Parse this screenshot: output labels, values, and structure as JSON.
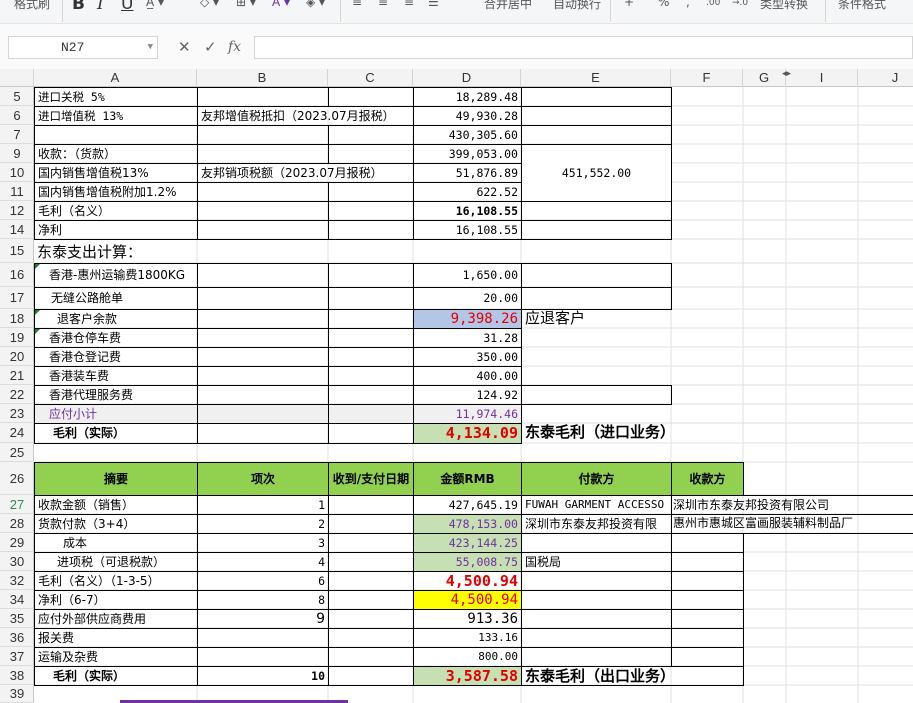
{
  "ribbon": {
    "format_label": "格式刷",
    "bold_icon": "B",
    "italic_icon": "I",
    "underline_icon": "U",
    "merge_label": "合并居中",
    "wrap_label": "自动换行",
    "plus_icon": "+",
    "percent_icon": "%",
    "dec_inc": ".00",
    "dec_dec": "→.0",
    "type_convert": "类型转换",
    "cond_format": "条件格式"
  },
  "formula_bar": {
    "name_box": "N27",
    "cancel_icon": "✕",
    "confirm_icon": "✓",
    "fx_icon": "fx",
    "formula": ""
  },
  "columns": [
    "A",
    "B",
    "C",
    "D",
    "E",
    "F",
    "G",
    "I",
    "J"
  ],
  "rows": [
    "5",
    "6",
    "7",
    "9",
    "10",
    "11",
    "12",
    "14",
    "15",
    "16",
    "17",
    "18",
    "19",
    "20",
    "21",
    "22",
    "23",
    "24",
    "25",
    "26",
    "27",
    "28",
    "29",
    "30",
    "32",
    "34",
    "35",
    "36",
    "37",
    "38",
    "39"
  ],
  "cells": {
    "r5": {
      "a": "进口关税 5%",
      "d": "18,289.48"
    },
    "r6": {
      "a": "进口增值税 13%",
      "b": "友邦增值税抵扣（2023.07月报税）",
      "d": "49,930.28"
    },
    "r7": {
      "d": "430,305.60"
    },
    "r9": {
      "a": "收款：（货款）",
      "d": "399,053.00"
    },
    "r10": {
      "a": "国内销售增值税13%",
      "b": "友邦销项税额（2023.07月报税）",
      "d": "51,876.89",
      "e": "451,552.00"
    },
    "r11": {
      "a": "国内销售增值税附加1.2%",
      "d": "622.52"
    },
    "r12": {
      "a": "毛利（名义）",
      "d": "16,108.55"
    },
    "r14": {
      "a": "净利",
      "d": "16,108.55"
    },
    "r15": {
      "a": "东泰支出计算："
    },
    "r16": {
      "a": "香港-惠州运输费1800KG",
      "d": "1,650.00"
    },
    "r17": {
      "a": "无缝公路舱单",
      "d": "20.00"
    },
    "r18": {
      "a": "退客户余款",
      "d": "9,398.26",
      "e": "应退客户"
    },
    "r19": {
      "a": "香港仓停车费",
      "d": "31.28"
    },
    "r20": {
      "a": "香港仓登记费",
      "d": "350.00"
    },
    "r21": {
      "a": "香港装车费",
      "d": "400.00"
    },
    "r22": {
      "a": "香港代理服务费",
      "d": "124.92"
    },
    "r23": {
      "a": "应付小计",
      "d": "11,974.46"
    },
    "r24": {
      "a": "毛利（实际）",
      "d": "4,134.09",
      "e": "东泰毛利（进口业务）"
    },
    "r26": {
      "a": "摘要",
      "b": "项次",
      "c": "收到/支付日期",
      "d": "金额RMB",
      "e": "付款方",
      "f": "收款方"
    },
    "r27": {
      "a": "收款金额（销售）",
      "b": "1",
      "d": "427,645.19",
      "e": "FUWAH GARMENT ACCESSO",
      "f": "深圳市东泰友邦投资有限公司"
    },
    "r28": {
      "a": "货款付款（3+4）",
      "b": "2",
      "d": "478,153.00",
      "e": "深圳市东泰友邦投资有限",
      "f": "惠州市惠城区富画服装辅料制品厂"
    },
    "r29": {
      "a": "成本",
      "b": "3",
      "d": "423,144.25"
    },
    "r30": {
      "a": "进项税（可退税款）",
      "b": "4",
      "d": "55,008.75",
      "e": "国税局"
    },
    "r32": {
      "a": "毛利（名义）（1-3-5）",
      "b": "6",
      "d": "4,500.94"
    },
    "r34": {
      "a": "净利（6-7）",
      "b": "8",
      "d": "4,500.94"
    },
    "r35": {
      "a": "应付外部供应商费用",
      "b": "9",
      "d": "913.36"
    },
    "r36": {
      "a": "报关费",
      "d": "133.16"
    },
    "r37": {
      "a": "运输及杂费",
      "d": "800.00"
    },
    "r38": {
      "a": "毛利（实际）",
      "b": "10",
      "d": "3,587.58",
      "e": "东泰毛利（出口业务）"
    }
  },
  "colors": {
    "header_green": "#92d050",
    "value_green": "#c6e0b4",
    "value_blue": "#b4c6e7",
    "highlight_yellow": "#ffff00",
    "red_text": "#e00000",
    "purple_text": "#7030a0"
  }
}
